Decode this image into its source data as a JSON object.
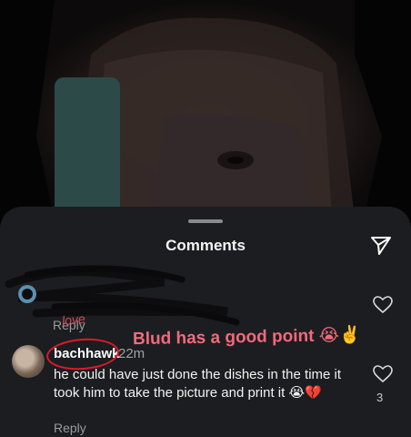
{
  "sheet": {
    "title": "Comments"
  },
  "comment_hidden": {
    "reply_label": "Reply",
    "handwritten_overlay": "love"
  },
  "comment_main": {
    "username": "bachhawk",
    "time": "22m",
    "text": "he could have just done the dishes in the time it took him to take the picture and print it 😭💔",
    "like_count": "3",
    "reply_label": "Reply"
  },
  "overlay": {
    "caption": "Blud has a good point 😭✌️"
  },
  "colors": {
    "sheet_bg": "#1c1d21",
    "overlay_text": "#f06b7a",
    "annotation_circle": "#e0182a"
  },
  "icons": {
    "share": "paper-plane-icon",
    "like": "heart-outline-icon"
  }
}
